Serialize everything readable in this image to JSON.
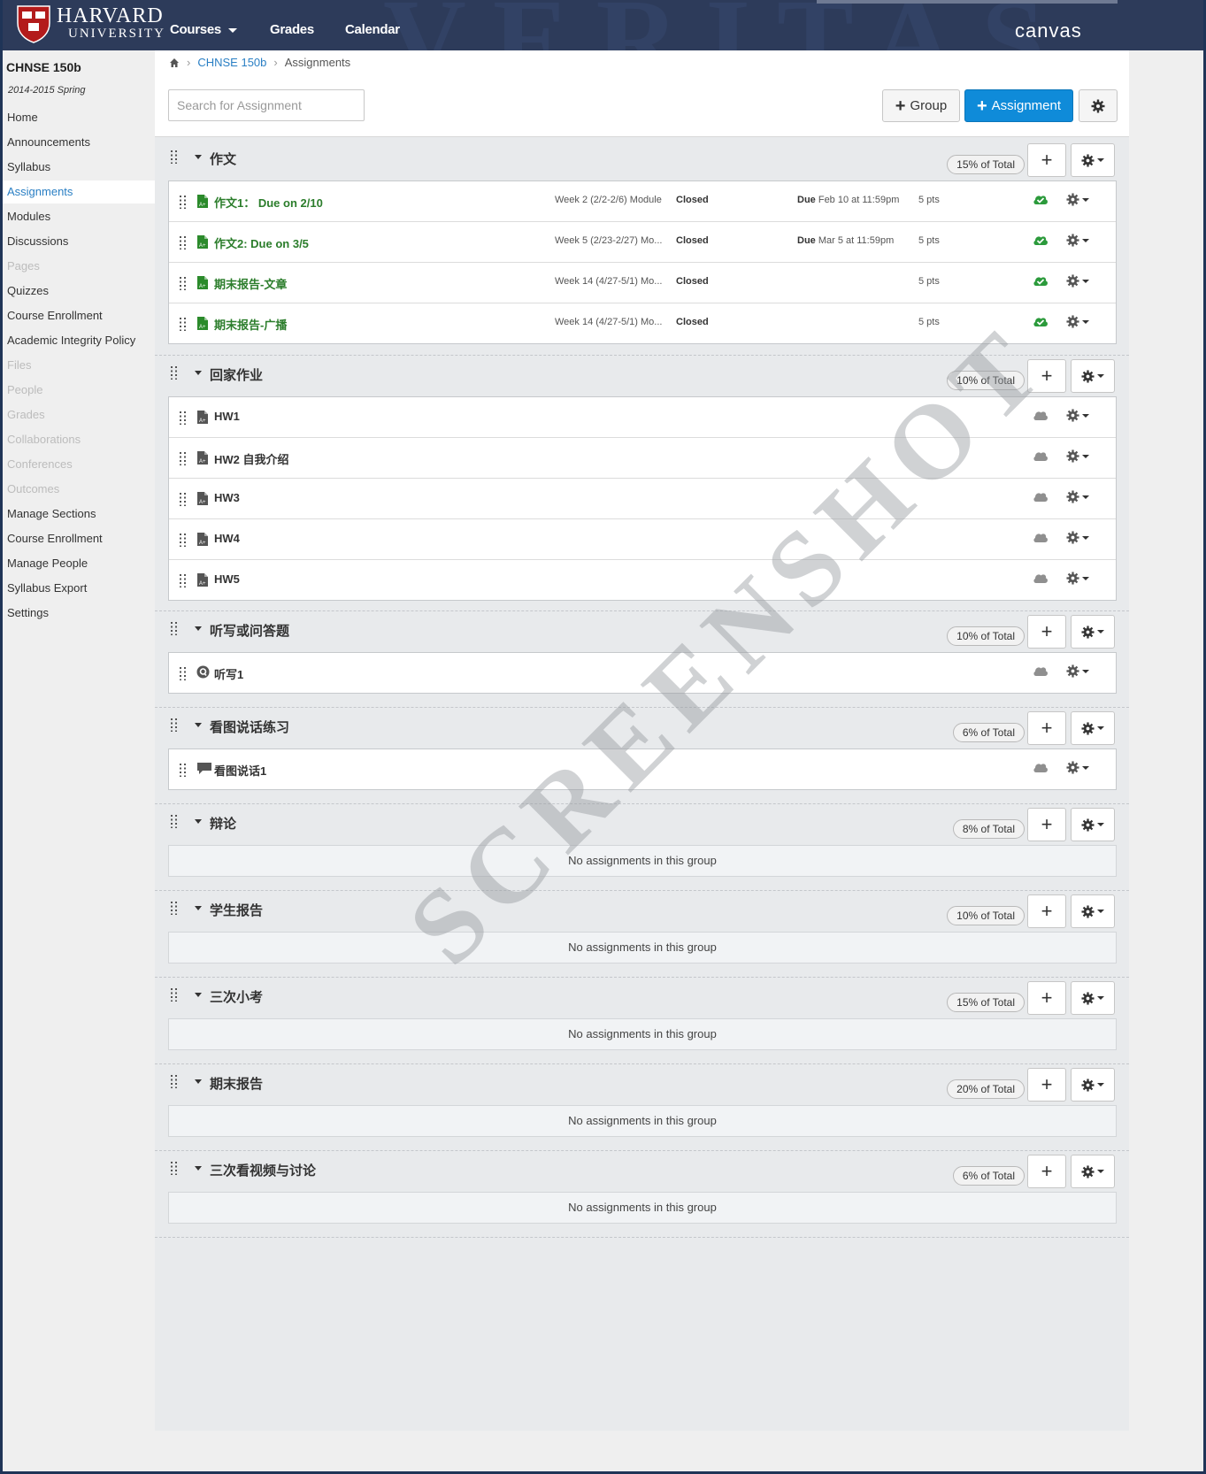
{
  "header": {
    "brand_line1": "HARVARD",
    "brand_line2": "UNIVERSITY",
    "nav": [
      {
        "label": "Courses"
      },
      {
        "label": "Grades"
      },
      {
        "label": "Calendar"
      }
    ],
    "canvas_label": "canvas"
  },
  "sidebar": {
    "course": "CHNSE 150b",
    "term": "2014-2015 Spring",
    "items": [
      {
        "label": "Home",
        "state": "normal"
      },
      {
        "label": "Announcements",
        "state": "normal"
      },
      {
        "label": "Syllabus",
        "state": "normal"
      },
      {
        "label": "Assignments",
        "state": "active"
      },
      {
        "label": "Modules",
        "state": "normal"
      },
      {
        "label": "Discussions",
        "state": "normal"
      },
      {
        "label": "Pages",
        "state": "dim"
      },
      {
        "label": "Quizzes",
        "state": "normal"
      },
      {
        "label": "Course Enrollment",
        "state": "normal"
      },
      {
        "label": "Academic Integrity Policy",
        "state": "normal"
      },
      {
        "label": "Files",
        "state": "dim"
      },
      {
        "label": "People",
        "state": "dim"
      },
      {
        "label": "Grades",
        "state": "dim"
      },
      {
        "label": "Collaborations",
        "state": "dim"
      },
      {
        "label": "Conferences",
        "state": "dim"
      },
      {
        "label": "Outcomes",
        "state": "dim"
      },
      {
        "label": "Manage Sections",
        "state": "normal"
      },
      {
        "label": "Course Enrollment",
        "state": "normal"
      },
      {
        "label": "Manage People",
        "state": "normal"
      },
      {
        "label": "Syllabus Export",
        "state": "normal"
      },
      {
        "label": "Settings",
        "state": "normal"
      }
    ]
  },
  "breadcrumb": {
    "course": "CHNSE 150b",
    "current": "Assignments"
  },
  "toolbar": {
    "search_placeholder": "Search for Assignment",
    "group_label": "Group",
    "assignment_label": "Assignment"
  },
  "groups": [
    {
      "name": "作文",
      "weight": "15% of Total",
      "assignments": [
        {
          "title": "作文1： Due on 2/10",
          "type": "assignment",
          "published": true,
          "module": "Week 2 (2/2-2/6) Module",
          "status": "Closed",
          "due_label": "Due",
          "due": "Feb 10 at 11:59pm",
          "points": "5 pts"
        },
        {
          "title": "作文2: Due on 3/5",
          "type": "assignment",
          "published": true,
          "module": "Week 5 (2/23-2/27) Mo...",
          "status": "Closed",
          "due_label": "Due",
          "due": "Mar 5 at 11:59pm",
          "points": "5 pts"
        },
        {
          "title": "期末报告-文章",
          "type": "assignment",
          "published": true,
          "module": "Week 14 (4/27-5/1) Mo...",
          "status": "Closed",
          "due_label": "",
          "due": "",
          "points": "5 pts"
        },
        {
          "title": "期末报告-广播",
          "type": "assignment",
          "published": true,
          "module": "Week 14 (4/27-5/1) Mo...",
          "status": "Closed",
          "due_label": "",
          "due": "",
          "points": "5 pts"
        }
      ]
    },
    {
      "name": "回家作业",
      "weight": "10% of Total",
      "assignments": [
        {
          "title": "HW1",
          "type": "assignment",
          "published": false
        },
        {
          "title": "HW2 自我介绍",
          "type": "assignment",
          "published": false
        },
        {
          "title": "HW3",
          "type": "assignment",
          "published": false
        },
        {
          "title": "HW4",
          "type": "assignment",
          "published": false
        },
        {
          "title": "HW5",
          "type": "assignment",
          "published": false
        }
      ]
    },
    {
      "name": "听写或问答题",
      "weight": "10% of Total",
      "assignments": [
        {
          "title": "听写1",
          "type": "quiz",
          "published": false
        }
      ]
    },
    {
      "name": "看图说话练习",
      "weight": "6% of Total",
      "assignments": [
        {
          "title": "看图说话1",
          "type": "discussion",
          "published": false
        }
      ]
    },
    {
      "name": "辩论",
      "weight": "8% of Total",
      "assignments": []
    },
    {
      "name": "学生报告",
      "weight": "10% of Total",
      "assignments": []
    },
    {
      "name": "三次小考",
      "weight": "15% of Total",
      "assignments": []
    },
    {
      "name": "期末报告",
      "weight": "20% of Total",
      "assignments": []
    },
    {
      "name": "三次看视频与讨论",
      "weight": "6% of Total",
      "assignments": []
    }
  ],
  "empty_group_text": "No assignments in this group",
  "watermark": "SCREENSHOT",
  "colors": {
    "topbar": "#2d3b5a",
    "primary_button": "#0f8bd9",
    "link": "#2a7fc4",
    "published": "#2b7d2b"
  }
}
